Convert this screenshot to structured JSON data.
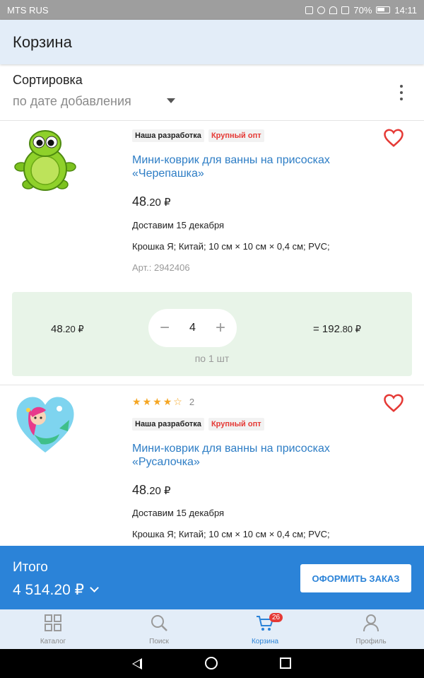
{
  "status_bar": {
    "carrier": "MTS RUS",
    "battery": "70%",
    "time": "14:11"
  },
  "header": {
    "title": "Корзина"
  },
  "sort": {
    "label": "Сортировка",
    "value": "по дате добавления"
  },
  "products": [
    {
      "badges": [
        "Наша разработка",
        "Крупный опт"
      ],
      "title_line1": "Мини-коврик для ванны на присосках",
      "title_line2": "«Черепашка»",
      "price_int": "48",
      "price_frac": ".20 ₽",
      "delivery": "Доставим 15 декабря",
      "specs": "Крошка Я; Китай; 10 см × 10 см × 0,4 см; PVC;",
      "article": "Арт.: 2942406",
      "unit_price_int": "48",
      "unit_price_frac": ".20 ₽",
      "quantity": "4",
      "minus": "−",
      "plus": "+",
      "per_unit": "по 1 шт",
      "total_int": "= 192",
      "total_frac": ".80 ₽"
    },
    {
      "rating": 4,
      "rating_count": "2",
      "badges": [
        "Наша разработка",
        "Крупный опт"
      ],
      "title_line1": "Мини-коврик для ванны на присосках",
      "title_line2": "«Русалочка»",
      "price_int": "48",
      "price_frac": ".20 ₽",
      "delivery": "Доставим 15 декабря",
      "specs": "Крошка Я; Китай; 10 см × 10 см × 0,4 см; PVC;"
    }
  ],
  "totals": {
    "label": "Итого",
    "value": "4 514.20 ₽",
    "checkout_label": "ОФОРМИТЬ ЗАКАЗ"
  },
  "bottom_nav": [
    {
      "label": "Каталог",
      "icon": "grid-icon"
    },
    {
      "label": "Поиск",
      "icon": "search-icon"
    },
    {
      "label": "Корзина",
      "icon": "cart-icon",
      "badge": "26",
      "active": true
    },
    {
      "label": "Профиль",
      "icon": "profile-icon"
    }
  ],
  "colors": {
    "accent": "#2b83d8",
    "link": "#2d7dc5",
    "heart": "#e53935",
    "qty_bg": "#e8f4e8",
    "header_bg": "#e3edf8"
  }
}
